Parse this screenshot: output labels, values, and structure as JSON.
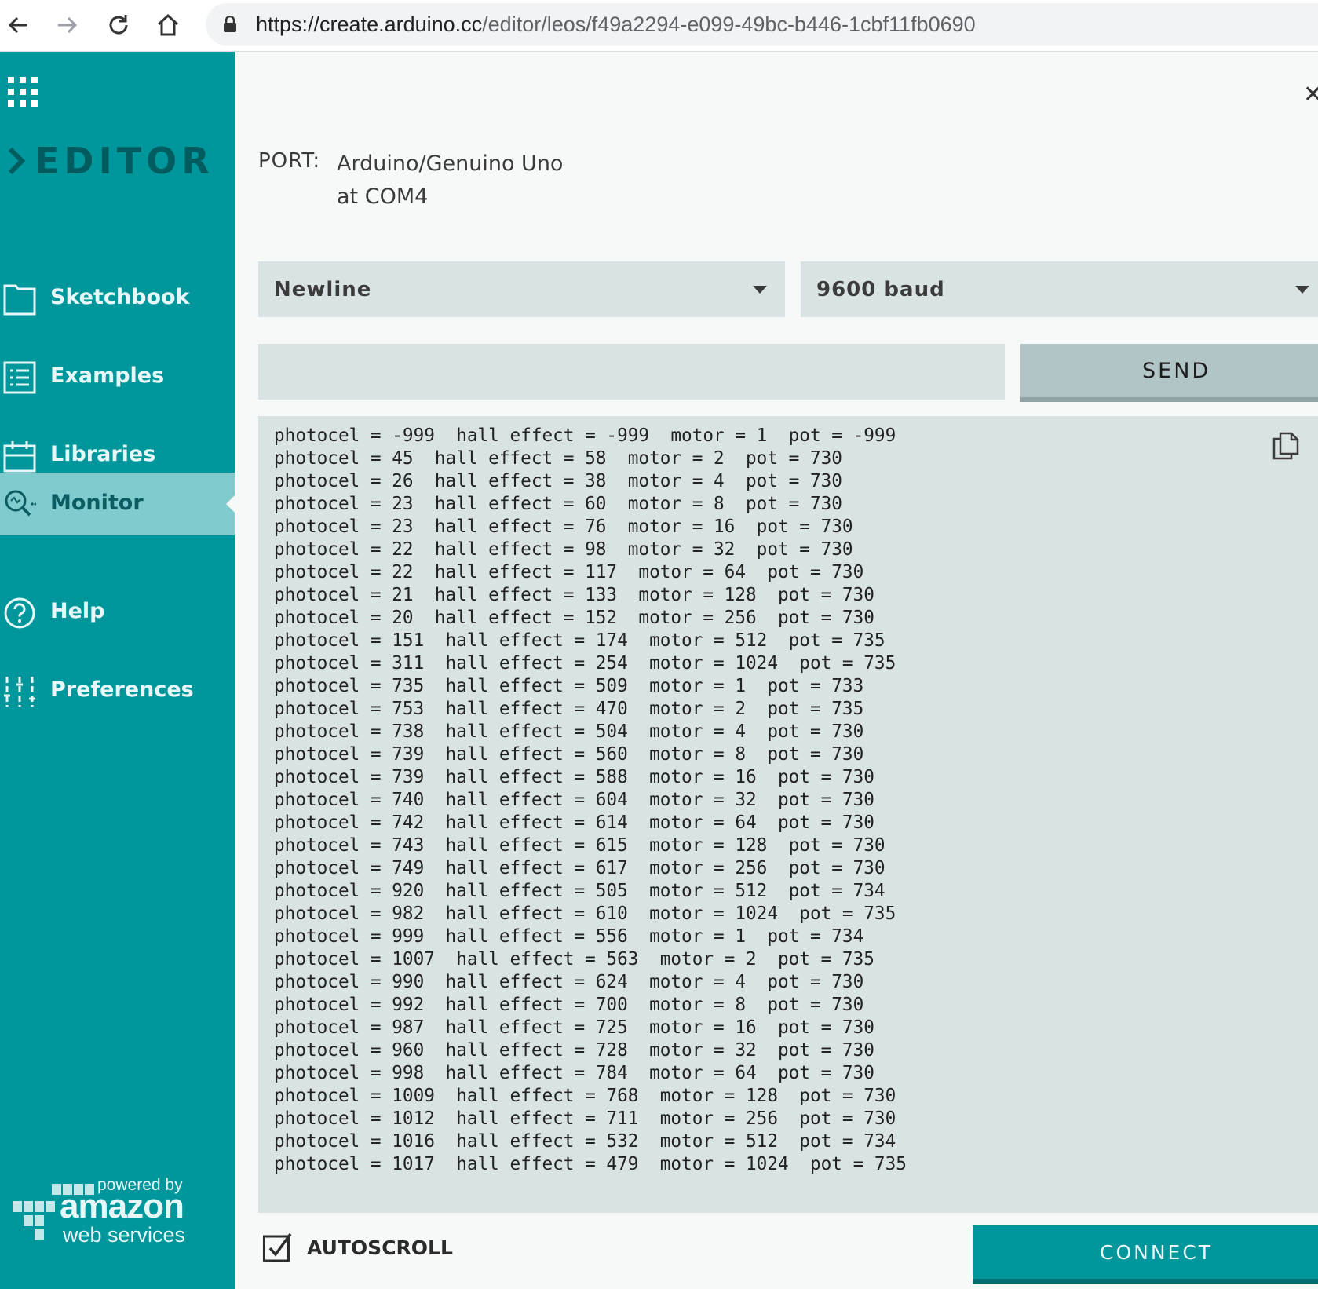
{
  "browser": {
    "url_host": "https://create.arduino.cc",
    "url_path": "/editor/leos/f49a2294-e099-49bc-b446-1cbf11fb0690"
  },
  "sidebar": {
    "brand": "EDITOR",
    "items": [
      {
        "label": "Sketchbook",
        "icon": "folder-icon"
      },
      {
        "label": "Examples",
        "icon": "list-icon"
      },
      {
        "label": "Libraries",
        "icon": "libraries-icon"
      },
      {
        "label": "Monitor",
        "icon": "monitor-search-icon",
        "active": true
      },
      {
        "label": "Help",
        "icon": "help-icon"
      },
      {
        "label": "Preferences",
        "icon": "sliders-icon"
      }
    ],
    "aws": {
      "powered_by": "powered by",
      "amazon": "amazon",
      "web_services": "web services"
    }
  },
  "monitor": {
    "port_label": "PORT:",
    "port_value": "Arduino/Genuino Uno at COM4",
    "line_ending": "Newline",
    "baud": "9600 baud",
    "send_value": "",
    "send_label": "SEND",
    "output": "photocel = -999  hall effect = -999  motor = 1  pot = -999\nphotocel = 45  hall effect = 58  motor = 2  pot = 730\nphotocel = 26  hall effect = 38  motor = 4  pot = 730\nphotocel = 23  hall effect = 60  motor = 8  pot = 730\nphotocel = 23  hall effect = 76  motor = 16  pot = 730\nphotocel = 22  hall effect = 98  motor = 32  pot = 730\nphotocel = 22  hall effect = 117  motor = 64  pot = 730\nphotocel = 21  hall effect = 133  motor = 128  pot = 730\nphotocel = 20  hall effect = 152  motor = 256  pot = 730\nphotocel = 151  hall effect = 174  motor = 512  pot = 735\nphotocel = 311  hall effect = 254  motor = 1024  pot = 735\nphotocel = 735  hall effect = 509  motor = 1  pot = 733\nphotocel = 753  hall effect = 470  motor = 2  pot = 735\nphotocel = 738  hall effect = 504  motor = 4  pot = 730\nphotocel = 739  hall effect = 560  motor = 8  pot = 730\nphotocel = 739  hall effect = 588  motor = 16  pot = 730\nphotocel = 740  hall effect = 604  motor = 32  pot = 730\nphotocel = 742  hall effect = 614  motor = 64  pot = 730\nphotocel = 743  hall effect = 615  motor = 128  pot = 730\nphotocel = 749  hall effect = 617  motor = 256  pot = 730\nphotocel = 920  hall effect = 505  motor = 512  pot = 734\nphotocel = 982  hall effect = 610  motor = 1024  pot = 735\nphotocel = 999  hall effect = 556  motor = 1  pot = 734\nphotocel = 1007  hall effect = 563  motor = 2  pot = 735\nphotocel = 990  hall effect = 624  motor = 4  pot = 730\nphotocel = 992  hall effect = 700  motor = 8  pot = 730\nphotocel = 987  hall effect = 725  motor = 16  pot = 730\nphotocel = 960  hall effect = 728  motor = 32  pot = 730\nphotocel = 998  hall effect = 784  motor = 64  pot = 730\nphotocel = 1009  hall effect = 768  motor = 128  pot = 730\nphotocel = 1012  hall effect = 711  motor = 256  pot = 730\nphotocel = 1016  hall effect = 532  motor = 512  pot = 734\nphotocel = 1017  hall effect = 479  motor = 1024  pot = 735",
    "autoscroll_label": "AUTOSCROLL",
    "autoscroll_checked": true,
    "connect_label": "CONNECT"
  },
  "colors": {
    "sidebar": "#00979c",
    "sidebar_active": "#7fcbcd",
    "panel": "#dae3e3",
    "send_button": "#b2c5c6",
    "connect_button": "#00979c"
  }
}
